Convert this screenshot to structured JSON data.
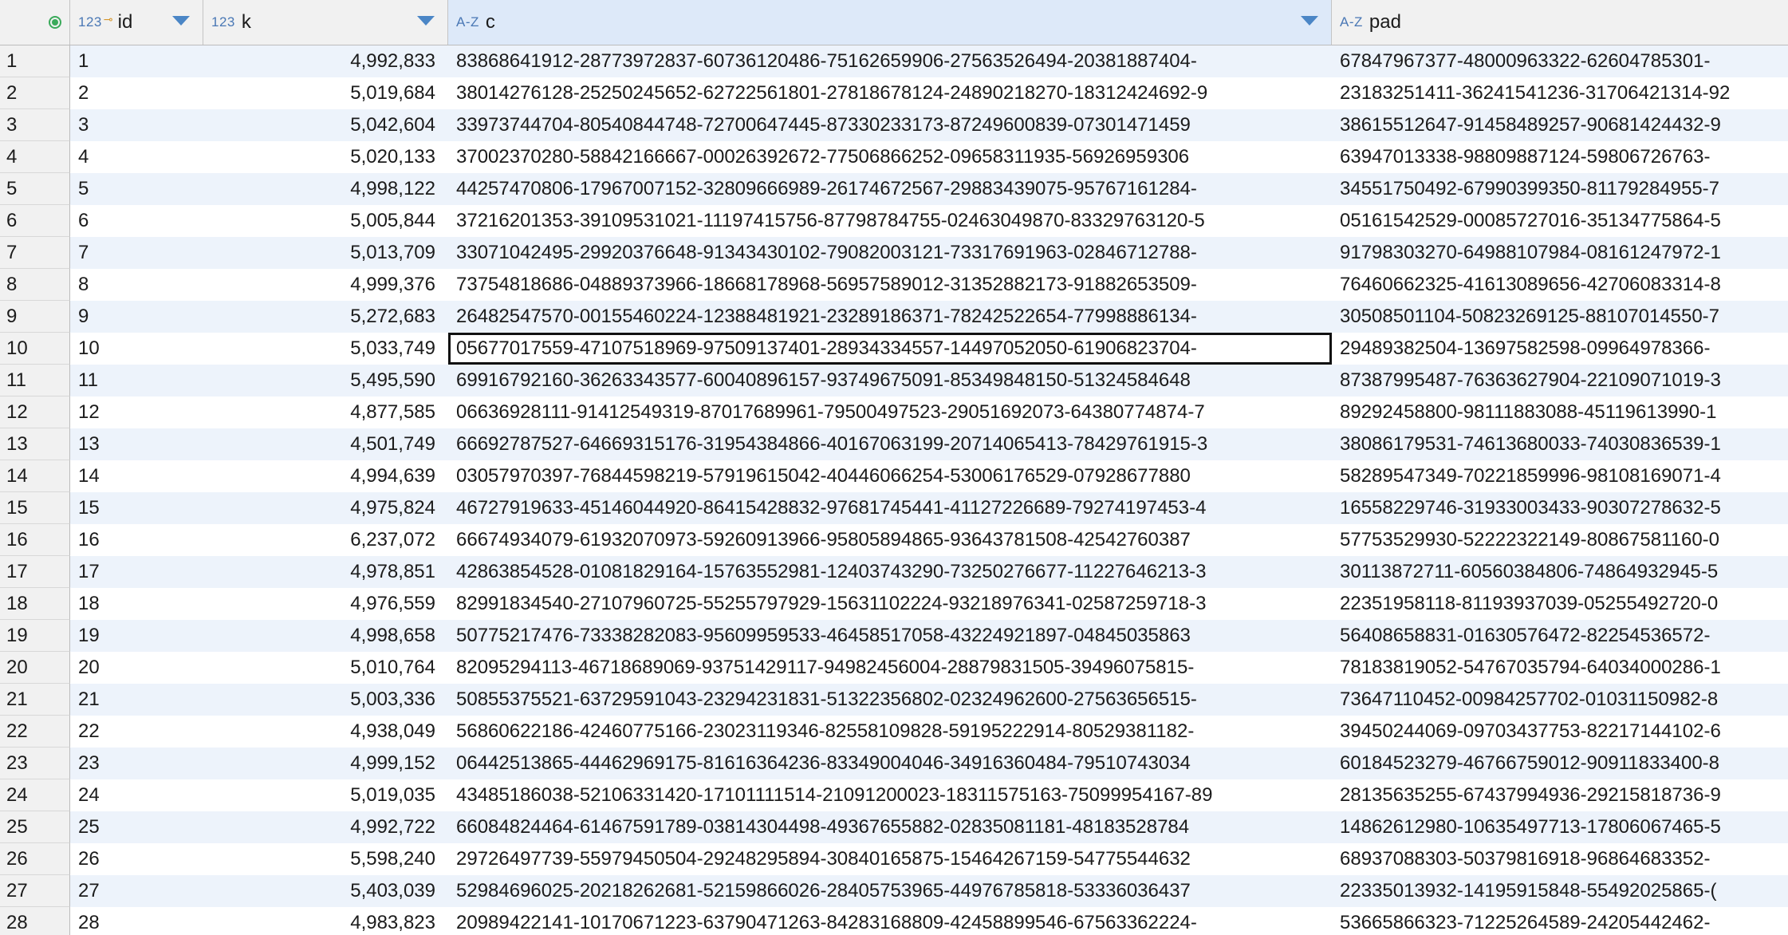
{
  "columns": {
    "id": {
      "type": "123",
      "name": "id"
    },
    "k": {
      "type": "123",
      "name": "k"
    },
    "c": {
      "type": "A-Z",
      "name": "c"
    },
    "pad": {
      "type": "A-Z",
      "name": "pad"
    }
  },
  "colors": {
    "accent": "#4b86c6",
    "row_alt": "#edf3fb",
    "selected_header": "#dde9f9",
    "key": "#d6962c",
    "status": "#3aaa5a"
  },
  "focused_row_index": 9,
  "rows": [
    {
      "n": "1",
      "id": "1",
      "k": "4,992,833",
      "c": "83868641912-28773972837-60736120486-75162659906-27563526494-20381887404-",
      "pad": "67847967377-48000963322-62604785301-"
    },
    {
      "n": "2",
      "id": "2",
      "k": "5,019,684",
      "c": "38014276128-25250245652-62722561801-27818678124-24890218270-18312424692-9",
      "pad": "23183251411-36241541236-31706421314-92"
    },
    {
      "n": "3",
      "id": "3",
      "k": "5,042,604",
      "c": "33973744704-80540844748-72700647445-87330233173-87249600839-07301471459",
      "pad": "38615512647-91458489257-90681424432-9"
    },
    {
      "n": "4",
      "id": "4",
      "k": "5,020,133",
      "c": "37002370280-58842166667-00026392672-77506866252-09658311935-56926959306",
      "pad": "63947013338-98809887124-59806726763-"
    },
    {
      "n": "5",
      "id": "5",
      "k": "4,998,122",
      "c": "44257470806-17967007152-32809666989-26174672567-29883439075-95767161284-",
      "pad": "34551750492-67990399350-81179284955-7"
    },
    {
      "n": "6",
      "id": "6",
      "k": "5,005,844",
      "c": "37216201353-39109531021-11197415756-87798784755-02463049870-83329763120-5",
      "pad": "05161542529-00085727016-35134775864-5"
    },
    {
      "n": "7",
      "id": "7",
      "k": "5,013,709",
      "c": "33071042495-29920376648-91343430102-79082003121-73317691963-02846712788-",
      "pad": "91798303270-64988107984-08161247972-1"
    },
    {
      "n": "8",
      "id": "8",
      "k": "4,999,376",
      "c": "73754818686-04889373966-18668178968-56957589012-31352882173-91882653509-",
      "pad": "76460662325-41613089656-42706083314-8"
    },
    {
      "n": "9",
      "id": "9",
      "k": "5,272,683",
      "c": "26482547570-00155460224-12388481921-23289186371-78242522654-77998886134-",
      "pad": "30508501104-50823269125-88107014550-7"
    },
    {
      "n": "10",
      "id": "10",
      "k": "5,033,749",
      "c": "05677017559-47107518969-97509137401-28934334557-14497052050-61906823704-",
      "pad": "29489382504-13697582598-09964978366-"
    },
    {
      "n": "11",
      "id": "11",
      "k": "5,495,590",
      "c": "69916792160-36263343577-60040896157-93749675091-85349848150-51324584648",
      "pad": "87387995487-76363627904-22109071019-3"
    },
    {
      "n": "12",
      "id": "12",
      "k": "4,877,585",
      "c": "06636928111-91412549319-87017689961-79500497523-29051692073-64380774874-7",
      "pad": "89292458800-98111883088-45119613990-1"
    },
    {
      "n": "13",
      "id": "13",
      "k": "4,501,749",
      "c": "66692787527-64669315176-31954384866-40167063199-20714065413-78429761915-3",
      "pad": "38086179531-74613680033-74030836539-1"
    },
    {
      "n": "14",
      "id": "14",
      "k": "4,994,639",
      "c": "03057970397-76844598219-57919615042-40446066254-53006176529-07928677880",
      "pad": "58289547349-70221859996-98108169071-4"
    },
    {
      "n": "15",
      "id": "15",
      "k": "4,975,824",
      "c": "46727919633-45146044920-86415428832-97681745441-41127226689-79274197453-4",
      "pad": "16558229746-31933003433-90307278632-5"
    },
    {
      "n": "16",
      "id": "16",
      "k": "6,237,072",
      "c": "66674934079-61932070973-59260913966-95805894865-93643781508-42542760387",
      "pad": "57753529930-52222322149-80867581160-0"
    },
    {
      "n": "17",
      "id": "17",
      "k": "4,978,851",
      "c": "42863854528-01081829164-15763552981-12403743290-73250276677-11227646213-3",
      "pad": "30113872711-60560384806-74864932945-5"
    },
    {
      "n": "18",
      "id": "18",
      "k": "4,976,559",
      "c": "82991834540-27107960725-55255797929-15631102224-93218976341-02587259718-3",
      "pad": "22351958118-81193937039-05255492720-0"
    },
    {
      "n": "19",
      "id": "19",
      "k": "4,998,658",
      "c": "50775217476-73338282083-95609959533-46458517058-43224921897-04845035863",
      "pad": "56408658831-01630576472-82254536572-"
    },
    {
      "n": "20",
      "id": "20",
      "k": "5,010,764",
      "c": "82095294113-46718689069-93751429117-94982456004-28879831505-39496075815-",
      "pad": "78183819052-54767035794-64034000286-1"
    },
    {
      "n": "21",
      "id": "21",
      "k": "5,003,336",
      "c": "50855375521-63729591043-23294231831-51322356802-02324962600-27563656515-",
      "pad": "73647110452-00984257702-01031150982-8"
    },
    {
      "n": "22",
      "id": "22",
      "k": "4,938,049",
      "c": "56860622186-42460775166-23023119346-82558109828-59195222914-80529381182-",
      "pad": "39450244069-09703437753-82217144102-6"
    },
    {
      "n": "23",
      "id": "23",
      "k": "4,999,152",
      "c": "06442513865-44462969175-81616364236-83349004046-34916360484-79510743034",
      "pad": "60184523279-46766759012-90911833400-8"
    },
    {
      "n": "24",
      "id": "24",
      "k": "5,019,035",
      "c": "43485186038-52106331420-17101111514-21091200023-18311575163-75099954167-89",
      "pad": "28135635255-67437994936-29215818736-9"
    },
    {
      "n": "25",
      "id": "25",
      "k": "4,992,722",
      "c": "66084824464-61467591789-03814304498-49367655882-02835081181-48183528784",
      "pad": "14862612980-10635497713-17806067465-5"
    },
    {
      "n": "26",
      "id": "26",
      "k": "5,598,240",
      "c": "29726497739-55979450504-29248295894-30840165875-15464267159-54775544632",
      "pad": "68937088303-50379816918-96864683352-"
    },
    {
      "n": "27",
      "id": "27",
      "k": "5,403,039",
      "c": "52984696025-20218262681-52159866026-28405753965-44976785818-53336036437",
      "pad": "22335013932-14195915848-55492025865-("
    },
    {
      "n": "28",
      "id": "28",
      "k": "4,983,823",
      "c": "20989422141-10170671223-63790471263-84283168809-42458899546-67563362224-",
      "pad": "53665866323-71225264589-24205442462-"
    }
  ]
}
